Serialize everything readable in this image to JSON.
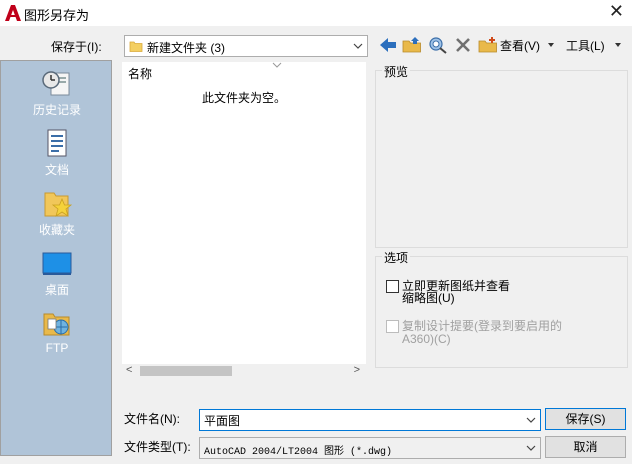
{
  "window": {
    "title": "图形另存为",
    "brand_color": "#c0001a"
  },
  "save_in": {
    "label": "保存于(I):",
    "value": "新建文件夹 (3)"
  },
  "toolbar": {
    "view_label": "查看(V)",
    "tools_label": "工具(L)",
    "icons": [
      "back-arrow-icon",
      "up-folder-icon",
      "search-web-icon",
      "delete-icon",
      "new-folder-icon"
    ]
  },
  "places": [
    {
      "label": "历史记录",
      "icon": "history-icon"
    },
    {
      "label": "文档",
      "icon": "documents-icon"
    },
    {
      "label": "收藏夹",
      "icon": "favorites-icon"
    },
    {
      "label": "桌面",
      "icon": "desktop-icon"
    },
    {
      "label": "FTP",
      "icon": "ftp-icon"
    }
  ],
  "file_list": {
    "column_name": "名称",
    "empty_message": "此文件夹为空。"
  },
  "preview": {
    "title": "预览"
  },
  "options": {
    "title": "选项",
    "update_thumbnail": {
      "label_line1": "立即更新图纸并查看",
      "label_line2": "缩略图(U)",
      "checked": false
    },
    "copy_design_feeds": {
      "label_line1": "复制设计提要(登录到要启用的",
      "label_line2": "A360)(C)",
      "checked": false,
      "enabled": false
    }
  },
  "filename": {
    "label": "文件名(N):",
    "value": "平面图"
  },
  "filetype": {
    "label": "文件类型(T):",
    "value": "AutoCAD 2004/LT2004 图形 (*.dwg)"
  },
  "buttons": {
    "save": "保存(S)",
    "cancel": "取消"
  }
}
